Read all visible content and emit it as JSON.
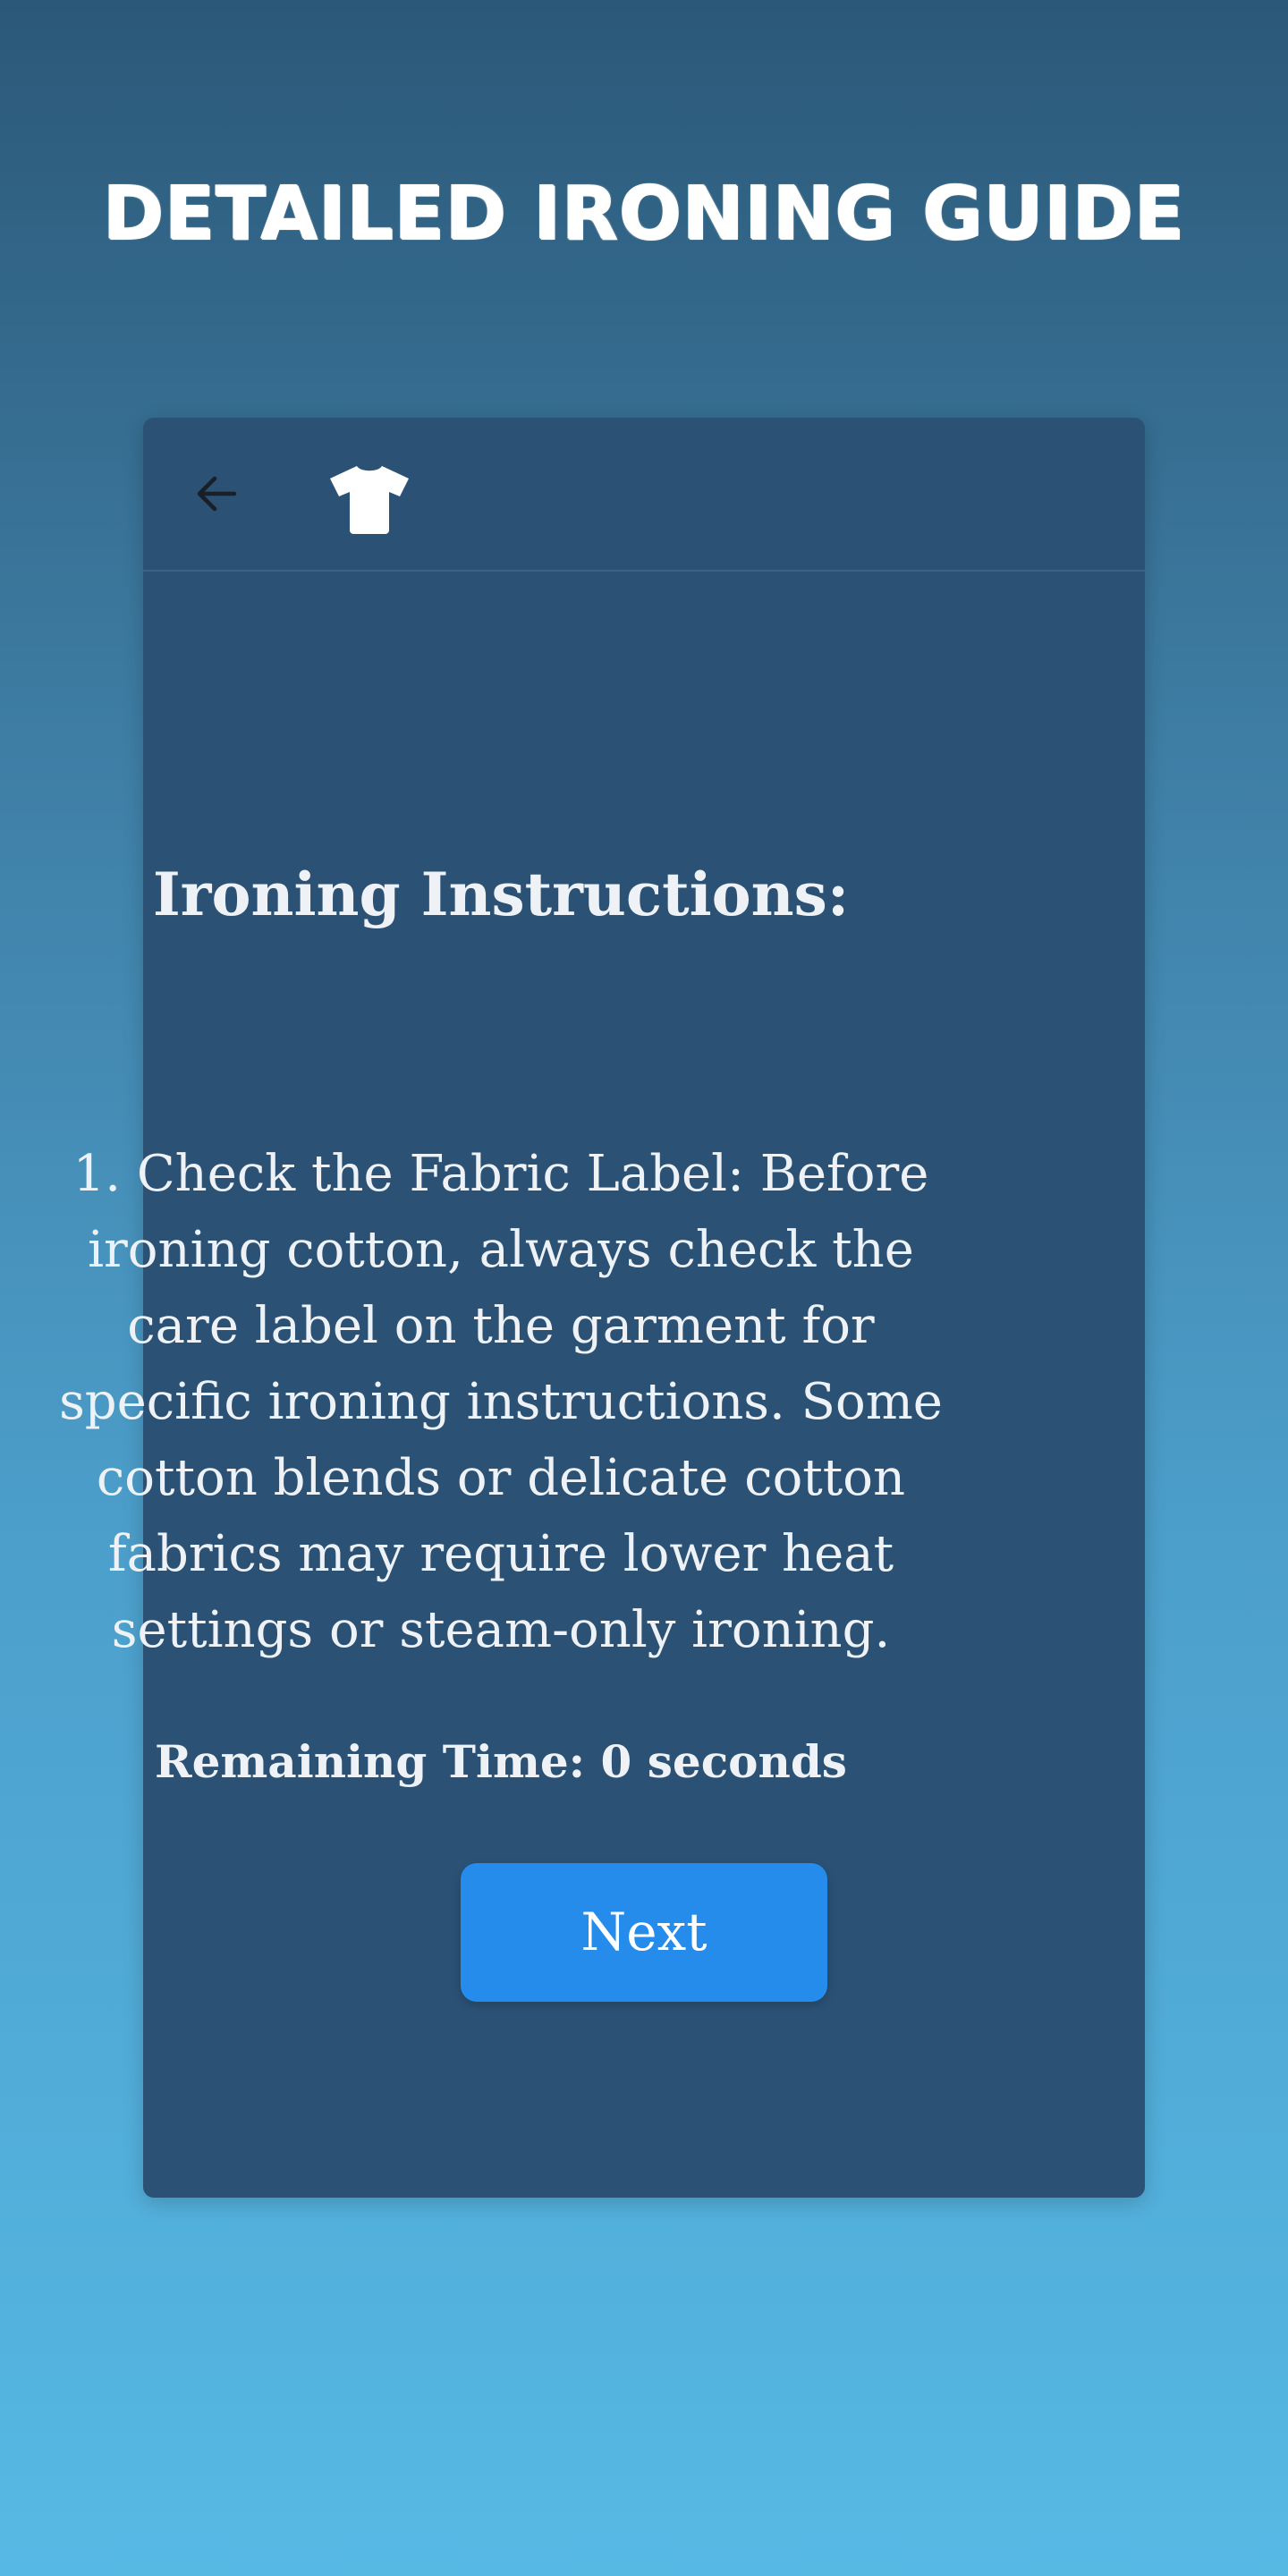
{
  "page": {
    "title": "DETAILED IRONING GUIDE"
  },
  "card": {
    "header": {
      "back_icon": "arrow-left-icon",
      "shirt_icon": "tshirt-icon"
    },
    "heading": "Ironing Instructions:",
    "instruction": "1. Check the Fabric Label: Before ironing cotton, always check the care label on the garment for specific ironing instructions. Some cotton blends or delicate cotton fabrics may require lower heat settings or steam-only ironing.",
    "remaining_time": "Remaining Time: 0 seconds",
    "next_label": "Next"
  },
  "colors": {
    "card_background": "#2b5175",
    "button": "#258cec",
    "gradient_top": "#2b5878",
    "gradient_bottom": "#56b9e4"
  }
}
